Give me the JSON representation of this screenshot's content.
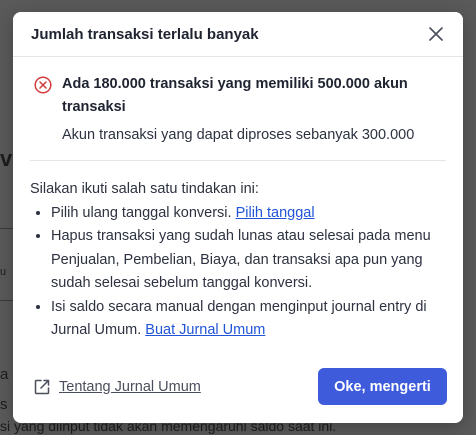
{
  "background": {
    "fragment_a": "v",
    "fragment_b": "u",
    "fragment_c": "a",
    "fragment_d": "s",
    "fragment_e": "si yang diinput tidak akan memengaruhi saldo saat ini."
  },
  "modal": {
    "title": "Jumlah transaksi terlalu banyak",
    "close_icon": "close-icon",
    "error": {
      "icon": "error-circle-icon",
      "color": "#d23c3c",
      "title": "Ada 180.000 transaksi yang memiliki 500.000 akun transaksi",
      "subtitle": "Akun transaksi yang dapat diproses sebanyak 300.000"
    },
    "instructions": {
      "intro": "Silakan ikuti salah satu tindakan ini:",
      "items": [
        {
          "text": "Pilih ulang tanggal konversi. ",
          "link": "Pilih tanggal"
        },
        {
          "text": "Hapus transaksi yang sudah lunas atau selesai pada menu Penjualan, Pembelian, Biaya, dan transaksi apa pun yang sudah selesai sebelum tanggal konversi.",
          "link": ""
        },
        {
          "text": "Isi saldo secara manual dengan menginput journal entry di Jurnal Umum. ",
          "link": "Buat Jurnal Umum"
        }
      ]
    },
    "footer": {
      "link_icon": "external-link-icon",
      "link_label": "Tentang Jurnal Umum",
      "primary_label": "Oke, mengerti"
    },
    "colors": {
      "primary": "#3d5bdb",
      "link": "#2154d6"
    }
  }
}
